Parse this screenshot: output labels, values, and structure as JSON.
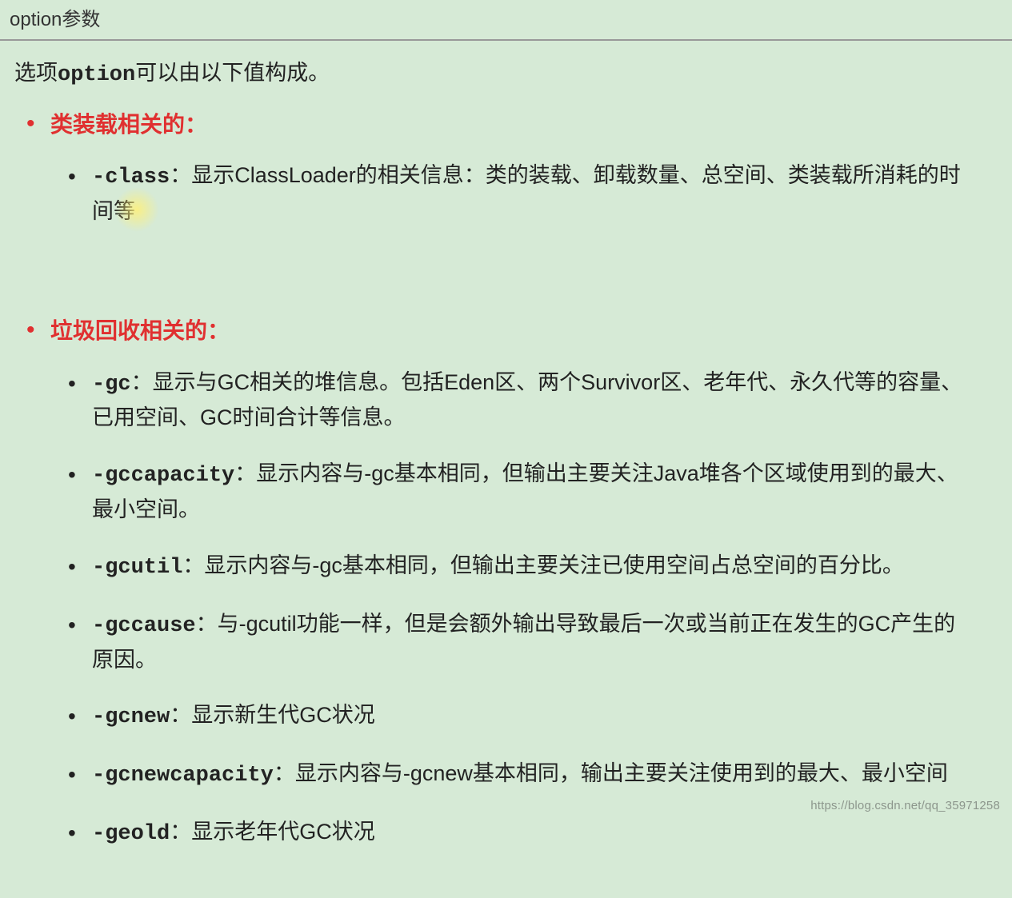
{
  "header": "option参数",
  "intro_pre": "选项",
  "intro_mono": "option",
  "intro_post": "可以由以下值构成。",
  "sections": [
    {
      "title": "类装载相关的：",
      "items": [
        {
          "opt": "-class",
          "colon": "：",
          "desc_a": "显示ClassLoader的相关信息：类的装载、卸载数量、总空间、类装载所消耗的时间等",
          "trailing_cursor": true
        }
      ]
    },
    {
      "title": "垃圾回收相关的：",
      "items": [
        {
          "opt": "-gc",
          "colon": "：",
          "desc_a": "显示与GC相关的堆信息。包括Eden区、两个Survivor区、老年代、永久代等的容量、已用空间、GC时间合计等信息。"
        },
        {
          "opt": "-gccapacity",
          "colon": "：",
          "desc_a": "显示内容与-gc基本相同，但输出主要关注Java堆各个区域使用到的最大、最小空间。"
        },
        {
          "opt": "-gcutil",
          "colon": "：",
          "desc_a": "显示内容与-gc基本相同，但输出主要关注已使用空间占总空间的百分比。"
        },
        {
          "opt": "-gccause",
          "colon": "：",
          "desc_a": "与-gcutil功能一样，但是会额外输出导致最后一次或当前正在发生的GC产生的原因。"
        },
        {
          "opt": "-gcnew",
          "colon": "：",
          "desc_a": "显示新生代GC状况"
        },
        {
          "opt": "-gcnewcapacity",
          "colon": "：",
          "desc_a": "显示内容与-gcnew基本相同，输出主要关注使用到的最大、最小空间"
        },
        {
          "opt": "-geold",
          "colon": "：",
          "desc_a": "显示老年代GC状况"
        }
      ]
    }
  ],
  "watermark": "https://blog.csdn.net/qq_35971258"
}
